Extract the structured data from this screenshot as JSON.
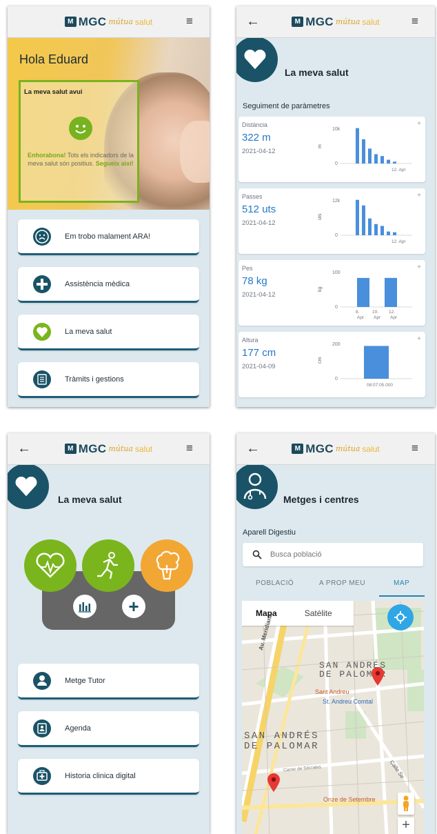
{
  "brand": {
    "short": "MGC",
    "mutua": "mútua",
    "salut": "salut",
    "mark": "M"
  },
  "colors": {
    "primary": "#1a5367",
    "accent_green": "#7ab51d",
    "accent_orange": "#f2a735",
    "link_blue": "#2477c9"
  },
  "screen1": {
    "greeting": "Hola Eduard",
    "panel": {
      "title": "La meva salut avui",
      "msg_bold": "Enhorabona!",
      "msg": "Tots els indicadors de la meva salut són positius.",
      "msg_link": "Segueix així!"
    },
    "cards": [
      {
        "label": "Em trobo malament ARA!",
        "icon": "sad-face-icon"
      },
      {
        "label": "Assistència mèdica",
        "icon": "medical-cross-icon"
      },
      {
        "label": "La meva salut",
        "icon": "heart-icon"
      },
      {
        "label": "Tràmits i gestions",
        "icon": "checklist-icon"
      }
    ]
  },
  "screen2": {
    "title": "La meva salut",
    "subtitle": "Seguiment de paràmetres",
    "metrics": [
      {
        "name": "Distància",
        "value": "322 m",
        "date": "2021-04-12",
        "unit": "m",
        "ymax": "10k",
        "ymin": "0",
        "xlabels": [
          "12. Apr"
        ],
        "bars": [
          0.95,
          0.65,
          0.4,
          0.25,
          0.2,
          0.1,
          0.05
        ]
      },
      {
        "name": "Passes",
        "value": "512 uts",
        "date": "2021-04-12",
        "unit": "uts",
        "ymax": "12k",
        "ymin": "0",
        "xlabels": [
          "12. Apr"
        ],
        "bars": [
          0.95,
          0.8,
          0.45,
          0.3,
          0.25,
          0.1,
          0.08
        ]
      },
      {
        "name": "Pes",
        "value": "78 kg",
        "date": "2021-04-12",
        "unit": "kg",
        "ymax": "100",
        "ymin": "0",
        "xlabels": [
          "8. Apr",
          "10. Apr",
          "12. Apr"
        ],
        "bars": [
          0.78,
          0.78
        ]
      },
      {
        "name": "Altura",
        "value": "177 cm",
        "date": "2021-04-09",
        "unit": "cm",
        "ymax": "200",
        "ymin": "0",
        "xlabels": [
          "08:07:05.000"
        ],
        "bars": [
          0.88
        ]
      }
    ]
  },
  "screen3": {
    "title": "La meva salut",
    "cards": [
      {
        "label": "Metge Tutor",
        "icon": "doctor-icon"
      },
      {
        "label": "Agenda",
        "icon": "agenda-icon"
      },
      {
        "label": "Historia clinica digital",
        "icon": "medical-case-icon"
      }
    ]
  },
  "screen4": {
    "title": "Metges i centres",
    "specialty": "Aparell Digestiu",
    "search_placeholder": "Busca població",
    "tabs": [
      "POBLACIÓ",
      "A PROP MEU",
      "MAP"
    ],
    "map": {
      "type_buttons": [
        "Mapa",
        "Satélite"
      ],
      "labels": [
        "SAN ANDRÉS",
        "DE PALOMAR",
        "Sant Andreu",
        "St. Andreu Comtal",
        "SAN ANDRÉS",
        "DE PALOMAR",
        "Onze de Setembre",
        "Av. Meridiana",
        "Carrer de Sócrates",
        "Calle Se"
      ]
    }
  }
}
